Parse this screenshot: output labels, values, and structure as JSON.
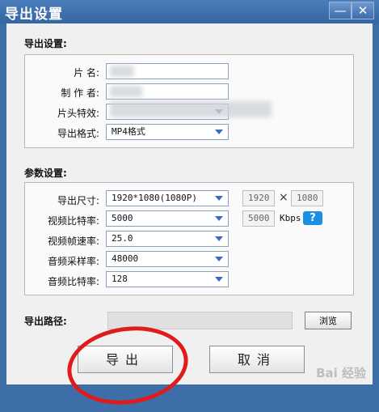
{
  "window": {
    "title": "导出设置",
    "minimize": "—",
    "close": "✕"
  },
  "export_section": {
    "title": "导出设置:",
    "name_label": "片     名:",
    "author_label": "制 作 者:",
    "intro_label": "片头特效:",
    "format_label": "导出格式:",
    "format_value": "MP4格式"
  },
  "params_section": {
    "title": "参数设置:",
    "size_label": "导出尺寸:",
    "size_value": "1920*1080(1080P)",
    "width_value": "1920",
    "height_value": "1080",
    "times": "×",
    "vbitrate_label": "视频比特率:",
    "vbitrate_value": "5000",
    "vbitrate_box": "5000",
    "kbps": "Kbps",
    "help": "?",
    "fps_label": "视频帧速率:",
    "fps_value": "25.0",
    "sample_label": "音频采样率:",
    "sample_value": "48000",
    "abitrate_label": "音频比特率:",
    "abitrate_value": "128"
  },
  "path": {
    "label": "导出路径:",
    "browse": "浏览"
  },
  "buttons": {
    "export": "导出",
    "cancel": "取消"
  },
  "watermark": "Bai 经验"
}
